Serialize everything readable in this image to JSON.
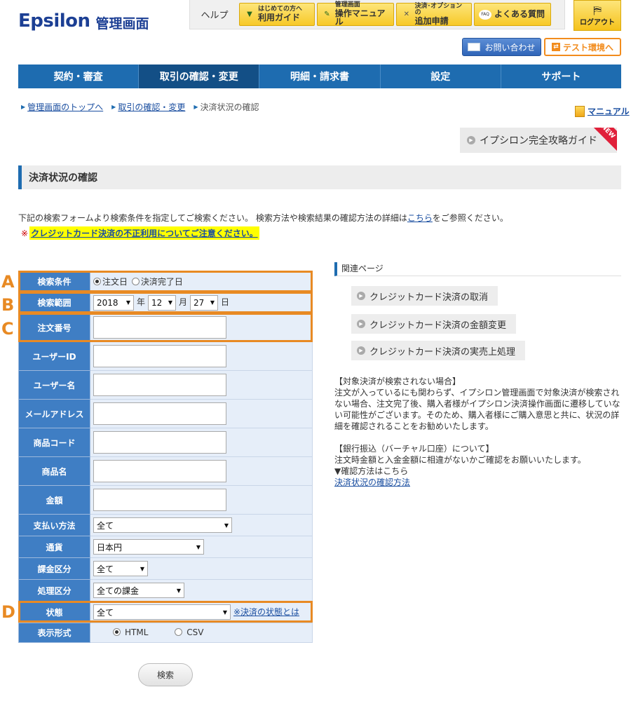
{
  "header": {
    "logo_word": "Epsilon",
    "logo_sub": "管理画面",
    "help_label": "ヘルプ",
    "help_buttons": [
      {
        "small": "はじめての方へ",
        "big": "利用ガイド",
        "icon": "beginner-icon"
      },
      {
        "small": "管理画面",
        "big": "操作マニュアル",
        "icon": "pencil-icon"
      },
      {
        "small": "決済･オプションの",
        "big": "追加申請",
        "icon": "tools-icon"
      },
      {
        "small": "",
        "big": "よくある質問",
        "icon": "faq-icon"
      }
    ],
    "logout_label": "ログアウト",
    "contact_label": "お問い合わせ",
    "test_label": "テスト環境へ"
  },
  "nav": {
    "items": [
      "契約・審査",
      "取引の確認・変更",
      "明細・請求書",
      "設定",
      "サポート"
    ],
    "active_index": 1
  },
  "breadcrumb": {
    "items": [
      "管理画面のトップへ",
      "取引の確認・変更",
      "決済状況の確認"
    ]
  },
  "manual_link": "マニュアル",
  "guide_button": {
    "label": "イプシロン完全攻略ガイド",
    "badge": "NEW"
  },
  "page_title": "決済状況の確認",
  "intro": {
    "before": "下記の検索フォームより検索条件を指定してご検索ください。 検索方法や検索結果の確認方法の詳細は",
    "link": "こちら",
    "after": "をご参照ください。"
  },
  "warning": {
    "mark": "※",
    "link": "クレジットカード決済の不正利用についてご注意ください。"
  },
  "form": {
    "search_condition": {
      "label": "検索条件",
      "options": [
        "注文日",
        "決済完了日"
      ],
      "selected": "注文日"
    },
    "search_range": {
      "label": "検索範囲",
      "year": "2018",
      "year_unit": "年",
      "month": "12",
      "month_unit": "月",
      "day": "27",
      "day_unit": "日"
    },
    "order_number": {
      "label": "注文番号",
      "value": ""
    },
    "user_id": {
      "label": "ユーザーID",
      "value": ""
    },
    "user_name": {
      "label": "ユーザー名",
      "value": ""
    },
    "email": {
      "label": "メールアドレス",
      "value": ""
    },
    "product_code": {
      "label": "商品コード",
      "value": ""
    },
    "product_name": {
      "label": "商品名",
      "value": ""
    },
    "amount": {
      "label": "金額",
      "value": ""
    },
    "payment_method": {
      "label": "支払い方法",
      "value": "全て"
    },
    "currency": {
      "label": "通貨",
      "value": "日本円"
    },
    "billing_type": {
      "label": "課金区分",
      "value": "全て"
    },
    "process_type": {
      "label": "処理区分",
      "value": "全ての課金"
    },
    "status": {
      "label": "状態",
      "value": "全て",
      "link": "※決済の状態とは"
    },
    "display_format": {
      "label": "表示形式",
      "options": [
        "HTML",
        "CSV"
      ],
      "selected": "HTML"
    },
    "search_button": "検索"
  },
  "annotations": [
    "A",
    "B",
    "C",
    "D"
  ],
  "highlight_color": "#e88a24",
  "related": {
    "title": "関連ページ",
    "buttons": [
      "クレジットカード決済の取消",
      "クレジットカード決済の金額変更",
      "クレジットカード決済の実売上処理"
    ]
  },
  "info": {
    "section1_title": "【対象決済が検索されない場合】",
    "section1_body": "注文が入っているにも関わらず、イプシロン管理画面で対象決済が検索されない場合、注文完了後、購入者様がイプシロン決済操作画面に遷移していない可能性がございます。そのため、購入者様にご購入意思と共に、状況の詳細を確認されることをお勧めいたします。",
    "section2_title": "【銀行振込（バーチャル口座）について】",
    "section2_body": "注文時金額と入金金額に相違がないかご確認をお願いいたします。",
    "section2_note": "▼確認方法はこちら",
    "section2_link": "決済状況の確認方法"
  }
}
